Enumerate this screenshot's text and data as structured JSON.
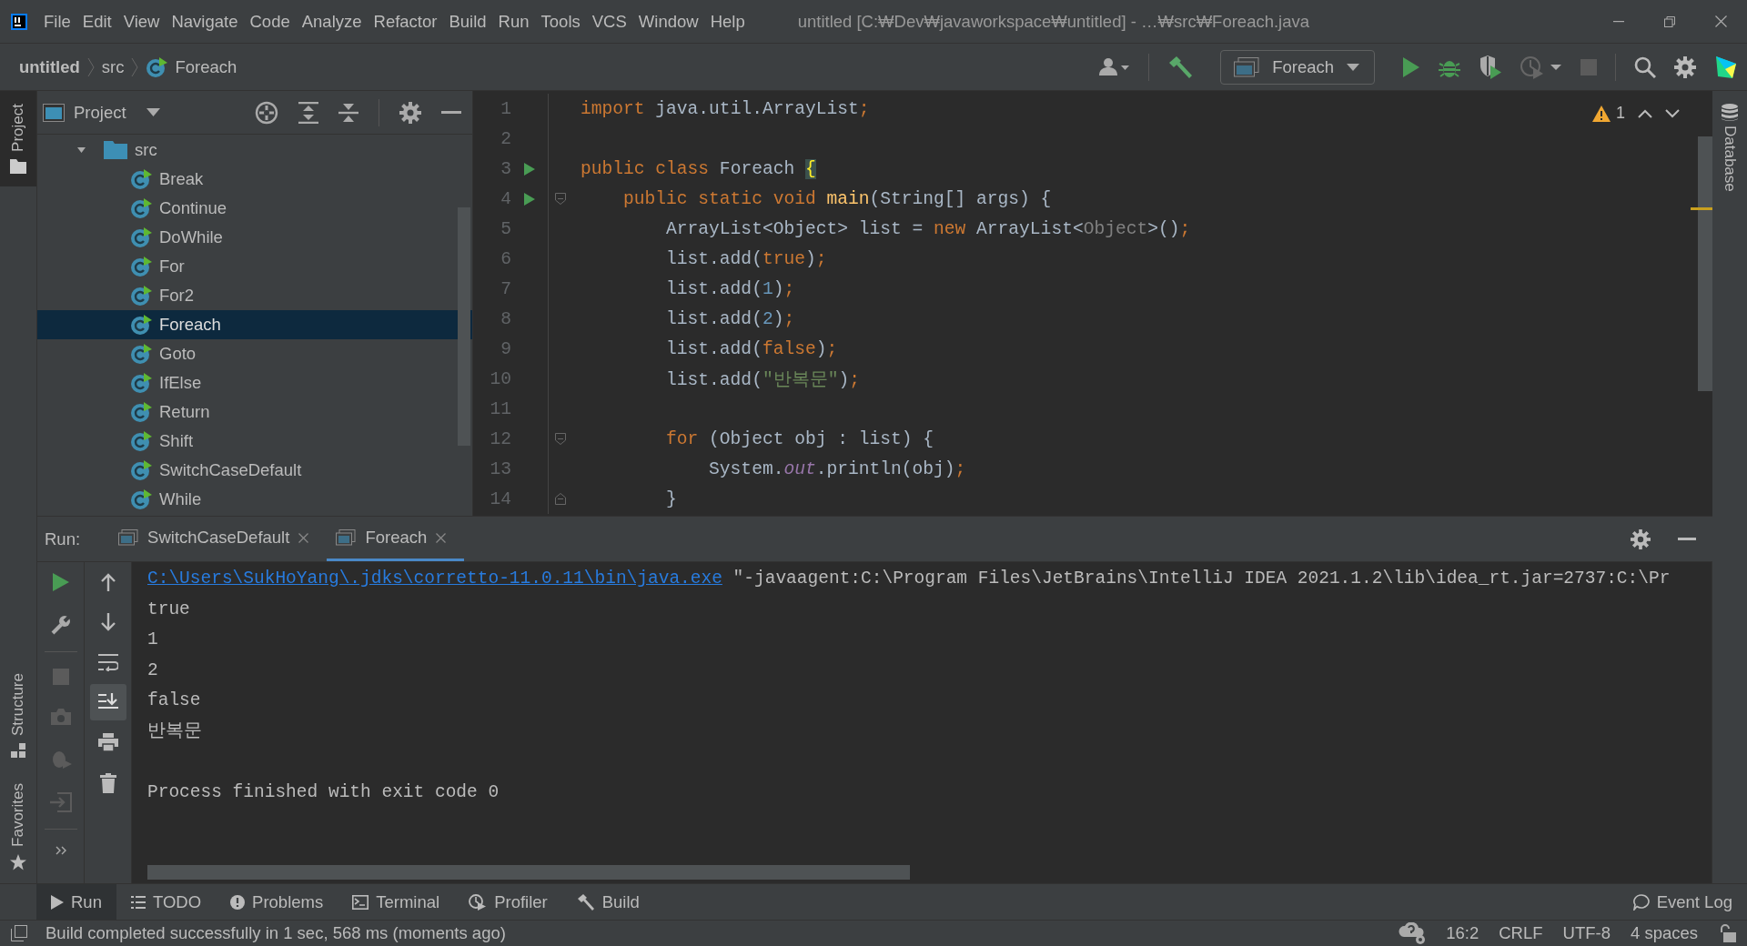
{
  "window": {
    "title": "untitled [C:₩Dev₩javaworkspace₩untitled] - …₩src₩Foreach.java"
  },
  "menu": [
    {
      "label": "File"
    },
    {
      "label": "Edit"
    },
    {
      "label": "View"
    },
    {
      "label": "Navigate"
    },
    {
      "label": "Code"
    },
    {
      "label": "Analyze"
    },
    {
      "label": "Refactor"
    },
    {
      "label": "Build"
    },
    {
      "label": "Run"
    },
    {
      "label": "Tools"
    },
    {
      "label": "VCS"
    },
    {
      "label": "Window"
    },
    {
      "label": "Help"
    }
  ],
  "breadcrumbs": [
    "untitled",
    "src",
    "Foreach"
  ],
  "run_configuration": "Foreach",
  "left_stripe": [
    {
      "label": "Project",
      "selected": true
    },
    {
      "label": "Structure",
      "selected": false
    },
    {
      "label": "Favorites",
      "selected": false
    }
  ],
  "right_stripe": [
    {
      "label": "Database",
      "selected": false
    }
  ],
  "project_panel": {
    "title": "Project",
    "tree": [
      {
        "label": "src",
        "kind": "folder",
        "expanded": true,
        "selected": false,
        "children": [
          {
            "label": "Break",
            "kind": "class",
            "selected": false
          },
          {
            "label": "Continue",
            "kind": "class",
            "selected": false
          },
          {
            "label": "DoWhile",
            "kind": "class",
            "selected": false
          },
          {
            "label": "For",
            "kind": "class",
            "selected": false
          },
          {
            "label": "For2",
            "kind": "class",
            "selected": false
          },
          {
            "label": "Foreach",
            "kind": "class",
            "selected": true
          },
          {
            "label": "Goto",
            "kind": "class",
            "selected": false
          },
          {
            "label": "IfElse",
            "kind": "class",
            "selected": false
          },
          {
            "label": "Return",
            "kind": "class",
            "selected": false
          },
          {
            "label": "Shift",
            "kind": "class",
            "selected": false
          },
          {
            "label": "SwitchCaseDefault",
            "kind": "class",
            "selected": false
          },
          {
            "label": "While",
            "kind": "class",
            "selected": false
          }
        ]
      }
    ]
  },
  "editor": {
    "warnings": "1",
    "lines": [
      {
        "number": "1",
        "run": false,
        "fold_start": false,
        "fold_end": false,
        "tokens": [
          {
            "kind": "kw",
            "t": "import"
          },
          {
            "kind": "txt",
            "t": " java.util.ArrayList"
          },
          {
            "kind": "semi",
            "t": ";"
          }
        ]
      },
      {
        "number": "2",
        "run": false,
        "fold_start": false,
        "fold_end": false
      },
      {
        "number": "3",
        "run": true,
        "fold_start": false,
        "fold_end": false,
        "tokens": [
          {
            "kind": "kw",
            "t": "public class"
          },
          {
            "kind": "txt",
            "t": " Foreach "
          },
          {
            "kind": "brace",
            "t": "{"
          }
        ]
      },
      {
        "number": "4",
        "run": true,
        "fold_start": true,
        "fold_end": false,
        "tokens": [
          {
            "kind": "kw",
            "t": "    public static void"
          },
          {
            "kind": "fn",
            "t": " main"
          },
          {
            "kind": "txt",
            "t": "(String[] args) {"
          }
        ]
      },
      {
        "number": "5",
        "run": false,
        "fold_start": false,
        "fold_end": false,
        "tokens": [
          {
            "kind": "txt",
            "t": "        ArrayList<Object> list = "
          },
          {
            "kind": "kw",
            "t": "new"
          },
          {
            "kind": "txt",
            "t": " ArrayList<"
          },
          {
            "kind": "dim",
            "t": "Object"
          },
          {
            "kind": "txt",
            "t": ">()"
          },
          {
            "kind": "semi",
            "t": ";"
          }
        ]
      },
      {
        "number": "6",
        "run": false,
        "fold_start": false,
        "fold_end": false,
        "tokens": [
          {
            "kind": "txt",
            "t": "        list.add("
          },
          {
            "kind": "kw",
            "t": "true"
          },
          {
            "kind": "txt",
            "t": ")"
          },
          {
            "kind": "semi",
            "t": ";"
          }
        ]
      },
      {
        "number": "7",
        "run": false,
        "fold_start": false,
        "fold_end": false,
        "tokens": [
          {
            "kind": "txt",
            "t": "        list.add("
          },
          {
            "kind": "num",
            "t": "1"
          },
          {
            "kind": "txt",
            "t": ")"
          },
          {
            "kind": "semi",
            "t": ";"
          }
        ]
      },
      {
        "number": "8",
        "run": false,
        "fold_start": false,
        "fold_end": false,
        "tokens": [
          {
            "kind": "txt",
            "t": "        list.add("
          },
          {
            "kind": "num",
            "t": "2"
          },
          {
            "kind": "txt",
            "t": ")"
          },
          {
            "kind": "semi",
            "t": ";"
          }
        ]
      },
      {
        "number": "9",
        "run": false,
        "fold_start": false,
        "fold_end": false,
        "tokens": [
          {
            "kind": "txt",
            "t": "        list.add("
          },
          {
            "kind": "kw",
            "t": "false"
          },
          {
            "kind": "txt",
            "t": ")"
          },
          {
            "kind": "semi",
            "t": ";"
          }
        ]
      },
      {
        "number": "10",
        "run": false,
        "fold_start": false,
        "fold_end": false,
        "tokens": [
          {
            "kind": "txt",
            "t": "        list.add("
          },
          {
            "kind": "str",
            "t": "\"반복문\""
          },
          {
            "kind": "txt",
            "t": ")"
          },
          {
            "kind": "semi",
            "t": ";"
          }
        ]
      },
      {
        "number": "11",
        "run": false,
        "fold_start": false,
        "fold_end": false
      },
      {
        "number": "12",
        "run": false,
        "fold_start": true,
        "fold_end": false,
        "tokens": [
          {
            "kind": "kw",
            "t": "        for"
          },
          {
            "kind": "txt",
            "t": " (Object obj : list) {"
          }
        ]
      },
      {
        "number": "13",
        "run": false,
        "fold_start": false,
        "fold_end": false,
        "tokens": [
          {
            "kind": "txt",
            "t": "            System."
          },
          {
            "kind": "field",
            "t": "out"
          },
          {
            "kind": "txt",
            "t": ".println(obj)"
          },
          {
            "kind": "semi",
            "t": ";"
          }
        ]
      },
      {
        "number": "14",
        "run": false,
        "fold_start": false,
        "fold_end": true,
        "tokens": [
          {
            "kind": "txt",
            "t": "        }"
          }
        ]
      }
    ]
  },
  "run_panel": {
    "label": "Run:",
    "tabs": [
      {
        "label": "SwitchCaseDefault",
        "selected": false
      },
      {
        "label": "Foreach",
        "selected": true
      }
    ],
    "console": [
      {
        "kind": "command",
        "link": "C:\\Users\\SukHoYang\\.jdks\\corretto-11.0.11\\bin\\java.exe",
        "text": " \"-javaagent:C:\\Program Files\\JetBrains\\IntelliJ IDEA 2021.1.2\\lib\\idea_rt.jar=2737:C:\\Pr"
      },
      {
        "kind": "output",
        "text": "true"
      },
      {
        "kind": "output",
        "text": "1"
      },
      {
        "kind": "output",
        "text": "2"
      },
      {
        "kind": "output",
        "text": "false"
      },
      {
        "kind": "output",
        "text": "반복문"
      },
      {
        "kind": "exit",
        "text": "Process finished with exit code 0"
      }
    ]
  },
  "tool_tabs": [
    {
      "label": "Run",
      "selected": true
    },
    {
      "label": "TODO",
      "selected": false
    },
    {
      "label": "Problems",
      "selected": false
    },
    {
      "label": "Terminal",
      "selected": false
    },
    {
      "label": "Profiler",
      "selected": false
    },
    {
      "label": "Build",
      "selected": false
    }
  ],
  "tool_tabs_right": [
    {
      "label": "Event Log",
      "selected": false
    }
  ],
  "status_bar": {
    "message": "Build completed successfully in 1 sec, 568 ms (moments ago)",
    "items": [
      "16:2",
      "CRLF",
      "UTF-8",
      "4 spaces"
    ]
  }
}
